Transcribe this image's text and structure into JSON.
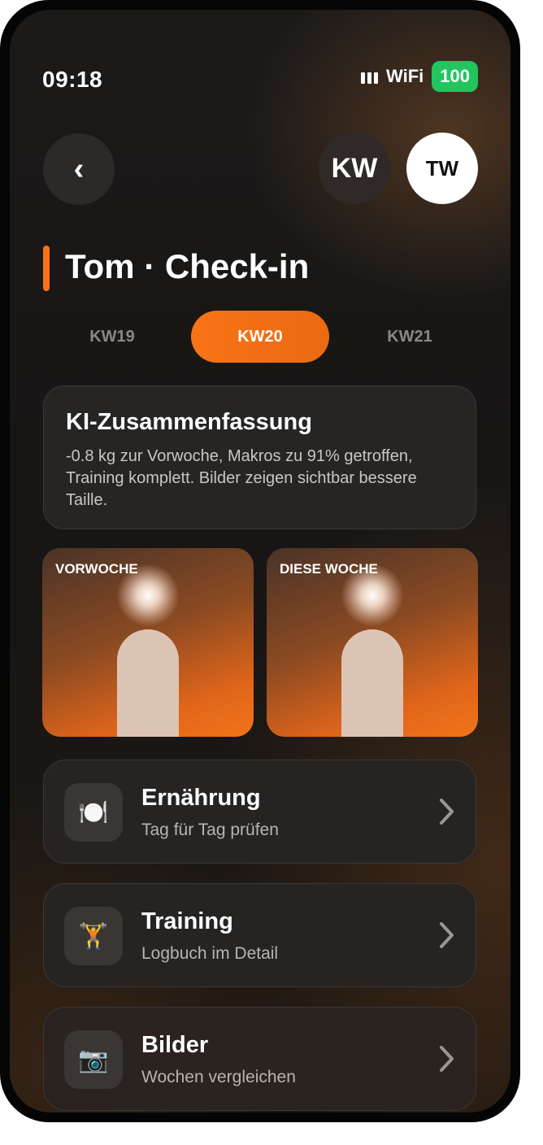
{
  "status": {
    "time": "09:18",
    "signal": "signal-bars-icon",
    "wifi": "WiFi",
    "battery": "100"
  },
  "header": {
    "back_label": "‹",
    "avatar_kw": "KW",
    "avatar_tw": "TW",
    "title": "Tom · Check-in"
  },
  "weeks": {
    "tabs": [
      {
        "label": "KW19",
        "active": false
      },
      {
        "label": "KW20",
        "active": true
      },
      {
        "label": "KW21",
        "active": false
      }
    ]
  },
  "summary": {
    "title": "KI-Zusammenfassung",
    "text": "-0.8 kg zur Vorwoche, Makros zu 91% getroffen, Training komplett. Bilder zeigen sichtbar bessere Taille."
  },
  "photos": {
    "previous_label": "VORWOCHE",
    "current_label": "DIESE WOCHE"
  },
  "cards": [
    {
      "icon": "🍽️",
      "icon_name": "plate-cutlery-icon",
      "title": "Ernährung",
      "subtitle": "Tag für Tag prüfen"
    },
    {
      "icon": "🏋️",
      "icon_name": "weightlifter-icon",
      "title": "Training",
      "subtitle": "Logbuch im Detail"
    },
    {
      "icon": "📷",
      "icon_name": "camera-icon",
      "title": "Bilder",
      "subtitle": "Wochen vergleichen"
    }
  ],
  "colors": {
    "accent": "#f97316",
    "battery": "#22c55e",
    "background": "#171615"
  }
}
